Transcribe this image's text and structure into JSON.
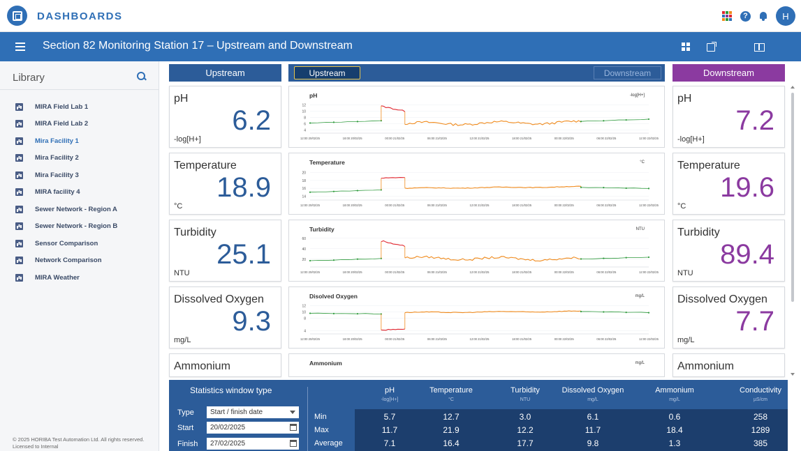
{
  "app": {
    "brand": "DASHBOARDS",
    "user_initial": "H"
  },
  "page": {
    "title": "Section 82 Monitoring Station 17 – Upstream and Downstream"
  },
  "library": {
    "heading": "Library",
    "items": [
      {
        "label": "MIRA Field Lab 1",
        "active": false
      },
      {
        "label": "MIRA Field Lab 2",
        "active": false
      },
      {
        "label": "Mira Facility 1",
        "active": true
      },
      {
        "label": "Mira Facility 2",
        "active": false
      },
      {
        "label": "Mira Facility 3",
        "active": false
      },
      {
        "label": "MIRA facility 4",
        "active": false
      },
      {
        "label": "Sewer Network - Region A",
        "active": false
      },
      {
        "label": "Sewer Network - Region B",
        "active": false
      },
      {
        "label": "Sensor Comparison",
        "active": false
      },
      {
        "label": "Network Comparison",
        "active": false
      },
      {
        "label": "MIRA Weather",
        "active": false
      }
    ],
    "copyright_line1": "© 2025 HORIBA Test Automation Ltd. All rights reserved.",
    "copyright_line2": "Licensed to Internal"
  },
  "headers": {
    "upstream": "Upstream",
    "upstream_toggle": "Upstream",
    "downstream_toggle": "Downstream",
    "downstream": "Downstream"
  },
  "upstream": [
    {
      "label": "pH",
      "value": "6.2",
      "unit": "-log[H+]"
    },
    {
      "label": "Temperature",
      "value": "18.9",
      "unit": "°C"
    },
    {
      "label": "Turbidity",
      "value": "25.1",
      "unit": "NTU"
    },
    {
      "label": "Dissolved Oxygen",
      "value": "9.3",
      "unit": "mg/L"
    },
    {
      "label": "Ammonium",
      "value": "",
      "unit": ""
    }
  ],
  "downstream": [
    {
      "label": "pH",
      "value": "7.2",
      "unit": "-log[H+]"
    },
    {
      "label": "Temperature",
      "value": "19.6",
      "unit": "°C"
    },
    {
      "label": "Turbidity",
      "value": "89.4",
      "unit": "NTU"
    },
    {
      "label": "Dissolved Oxygen",
      "value": "7.7",
      "unit": "mg/L"
    },
    {
      "label": "Ammonium",
      "value": "",
      "unit": ""
    }
  ],
  "colors": {
    "primary": "#2f6fb6",
    "upstream": "#2c5c99",
    "downstream": "#8b3aa0",
    "normal": "#2e9a3c",
    "high": "#e0262f",
    "warning": "#f08a1c",
    "stats_dark": "#1c3e6d"
  },
  "x_ticks": [
    "12:00 20/02/25",
    "18:00 20/02/25",
    "00:00 21/02/25",
    "06:00 21/02/25",
    "12:00 21/02/25",
    "18:00 21/02/25",
    "00:00 22/02/25",
    "06:00 22/02/25",
    "12:00 22/02/25"
  ],
  "chart_data": [
    {
      "type": "line",
      "title": "pH",
      "ylabel": "-log[H+]",
      "yticks": [
        4,
        6,
        8,
        10,
        12
      ],
      "ylim": [
        3,
        13
      ],
      "segments": [
        {
          "status": "normal",
          "x_start": 0.0,
          "x_end": 0.21,
          "y_start": 6.2,
          "y_end": 7.0,
          "noise": 0.15
        },
        {
          "status": "high",
          "x_start": 0.21,
          "x_end": 0.28,
          "y_start": 11.6,
          "y_end": 10.0,
          "noise": 0.4
        },
        {
          "status": "warning",
          "x_start": 0.28,
          "x_end": 0.8,
          "y_start": 6.0,
          "y_end": 6.4,
          "noise": 0.7
        },
        {
          "status": "normal",
          "x_start": 0.8,
          "x_end": 1.0,
          "y_start": 6.8,
          "y_end": 7.4,
          "noise": 0.15
        }
      ]
    },
    {
      "type": "line",
      "title": "Temperature",
      "ylabel": "°C",
      "yticks": [
        14,
        16,
        18,
        20
      ],
      "ylim": [
        13,
        21
      ],
      "segments": [
        {
          "status": "normal",
          "x_start": 0.0,
          "x_end": 0.21,
          "y_start": 15.0,
          "y_end": 15.6,
          "noise": 0.1
        },
        {
          "status": "high",
          "x_start": 0.21,
          "x_end": 0.28,
          "y_start": 18.6,
          "y_end": 18.8,
          "noise": 0.2
        },
        {
          "status": "warning",
          "x_start": 0.28,
          "x_end": 0.8,
          "y_start": 16.0,
          "y_end": 16.4,
          "noise": 0.15
        },
        {
          "status": "normal",
          "x_start": 0.8,
          "x_end": 1.0,
          "y_start": 16.2,
          "y_end": 16.0,
          "noise": 0.1
        }
      ]
    },
    {
      "type": "line",
      "title": "Turbidity",
      "ylabel": "NTU",
      "yticks": [
        20,
        40,
        60
      ],
      "ylim": [
        5,
        65
      ],
      "segments": [
        {
          "status": "normal",
          "x_start": 0.0,
          "x_end": 0.21,
          "y_start": 17.0,
          "y_end": 21.0,
          "noise": 1.0
        },
        {
          "status": "high",
          "x_start": 0.21,
          "x_end": 0.28,
          "y_start": 55.0,
          "y_end": 45.0,
          "noise": 3.0
        },
        {
          "status": "warning",
          "x_start": 0.28,
          "x_end": 0.8,
          "y_start": 22.0,
          "y_end": 20.0,
          "noise": 4.0
        },
        {
          "status": "normal",
          "x_start": 0.8,
          "x_end": 1.0,
          "y_start": 20.0,
          "y_end": 24.0,
          "noise": 1.0
        }
      ]
    },
    {
      "type": "line",
      "title": "Disolved Oxygen",
      "ylabel": "mg/L",
      "yticks": [
        4,
        8,
        10,
        12
      ],
      "ylim": [
        3,
        13
      ],
      "segments": [
        {
          "status": "normal",
          "x_start": 0.0,
          "x_end": 0.21,
          "y_start": 9.6,
          "y_end": 9.4,
          "noise": 0.15
        },
        {
          "status": "high",
          "x_start": 0.21,
          "x_end": 0.28,
          "y_start": 4.2,
          "y_end": 4.6,
          "noise": 0.3
        },
        {
          "status": "warning",
          "x_start": 0.28,
          "x_end": 0.8,
          "y_start": 9.8,
          "y_end": 10.2,
          "noise": 0.2
        },
        {
          "status": "normal",
          "x_start": 0.8,
          "x_end": 1.0,
          "y_start": 10.1,
          "y_end": 9.8,
          "noise": 0.15
        }
      ]
    },
    {
      "type": "line",
      "title": "Ammonium",
      "ylabel": "mg/L",
      "segments": []
    }
  ],
  "stats": {
    "title": "Statistics window type",
    "type_label": "Type",
    "type_value": "Start / finish date",
    "start_label": "Start",
    "start_value": "20/02/2025",
    "finish_label": "Finish",
    "finish_value": "27/02/2025",
    "columns": [
      {
        "name": "pH",
        "unit": "-log[H+]"
      },
      {
        "name": "Temperature",
        "unit": "°C"
      },
      {
        "name": "Turbidity",
        "unit": "NTU"
      },
      {
        "name": "Dissolved Oxygen",
        "unit": "mg/L"
      },
      {
        "name": "Ammonium",
        "unit": "mg/L"
      },
      {
        "name": "Conductivity",
        "unit": "µS/cm"
      }
    ],
    "rows": [
      {
        "label": "Min",
        "values": [
          "5.7",
          "12.7",
          "3.0",
          "6.1",
          "0.6",
          "258"
        ]
      },
      {
        "label": "Max",
        "values": [
          "11.7",
          "21.9",
          "12.2",
          "11.7",
          "18.4",
          "1289"
        ]
      },
      {
        "label": "Average",
        "values": [
          "7.1",
          "16.4",
          "17.7",
          "9.8",
          "1.3",
          "385"
        ]
      }
    ]
  }
}
